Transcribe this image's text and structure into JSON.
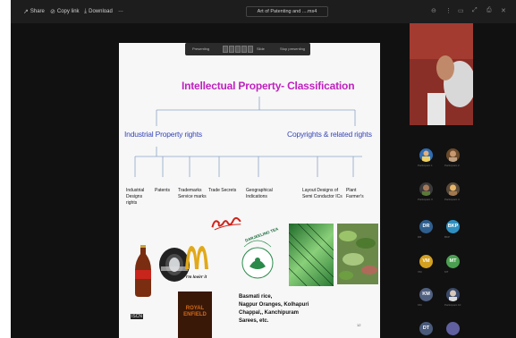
{
  "toolbar": {
    "share_label": "Share",
    "copy_label": "Copy link",
    "download_label": "Download",
    "more_label": "…",
    "doc_title": "Art of Patenting and ....ms4"
  },
  "presenter_bar": {
    "left_label": "Presenting",
    "mid_label": "Slide",
    "right_label": "Stop presenting"
  },
  "slide": {
    "title": "Intellectual Property- Classification",
    "branch_left": "Industrial Property rights",
    "branch_right": "Copyrights & related rights",
    "leaves": [
      {
        "line1": "Industrial",
        "line2": "Designs",
        "line3": "rights"
      },
      {
        "line1": "Patents",
        "line2": "",
        "line3": ""
      },
      {
        "line1": "Trademarks",
        "line2": "Service marks",
        "line3": ""
      },
      {
        "line1": "Trade Secrets",
        "line2": "",
        "line3": ""
      },
      {
        "line1": "Geographical",
        "line2": "Indications",
        "line3": ""
      },
      {
        "line1": "Layout Designs of",
        "line2": "Semi Conductor ICs",
        "line3": ""
      },
      {
        "line1": "Plant",
        "line2": "Farmer's",
        "line3": ""
      }
    ],
    "mcd_slogan": "I'm lovin' it",
    "darjeeling_label": "DARJEELING TEA",
    "royal_label": "ROYAL ENFIELD",
    "caption": [
      "Basmati rice,",
      "Nagpur Oranges, Kolhapuri",
      "Chappal,, Kanchipuram",
      "Sarees, etc."
    ],
    "slide_num": "12"
  },
  "participants": [
    {
      "name": "Participant 1",
      "color": "#2f6db5"
    },
    {
      "name": "Participant 2",
      "color": "#6a4a2a"
    },
    {
      "name": "Participant 3",
      "color": "#3a3a3a"
    },
    {
      "name": "Participant 4",
      "color": "#5a4a3a"
    },
    {
      "name": "DR",
      "color": "#2f5f8f",
      "initials": "DR"
    },
    {
      "name": "BKP",
      "color": "#2f8fc0",
      "initials": "BKP"
    },
    {
      "name": "VM",
      "color": "#d4a020",
      "initials": "VM"
    },
    {
      "name": "MT",
      "color": "#4aa050",
      "initials": "MT"
    },
    {
      "name": "KM",
      "color": "#506080",
      "initials": "KM"
    },
    {
      "name": "Participant 10",
      "color": "#3a4a6a"
    },
    {
      "name": "DT",
      "color": "#4a5a7a",
      "initials": "DT"
    },
    {
      "name": "Participant 12",
      "color": "#6060a0"
    }
  ],
  "bottom_left_label": "ISCN"
}
